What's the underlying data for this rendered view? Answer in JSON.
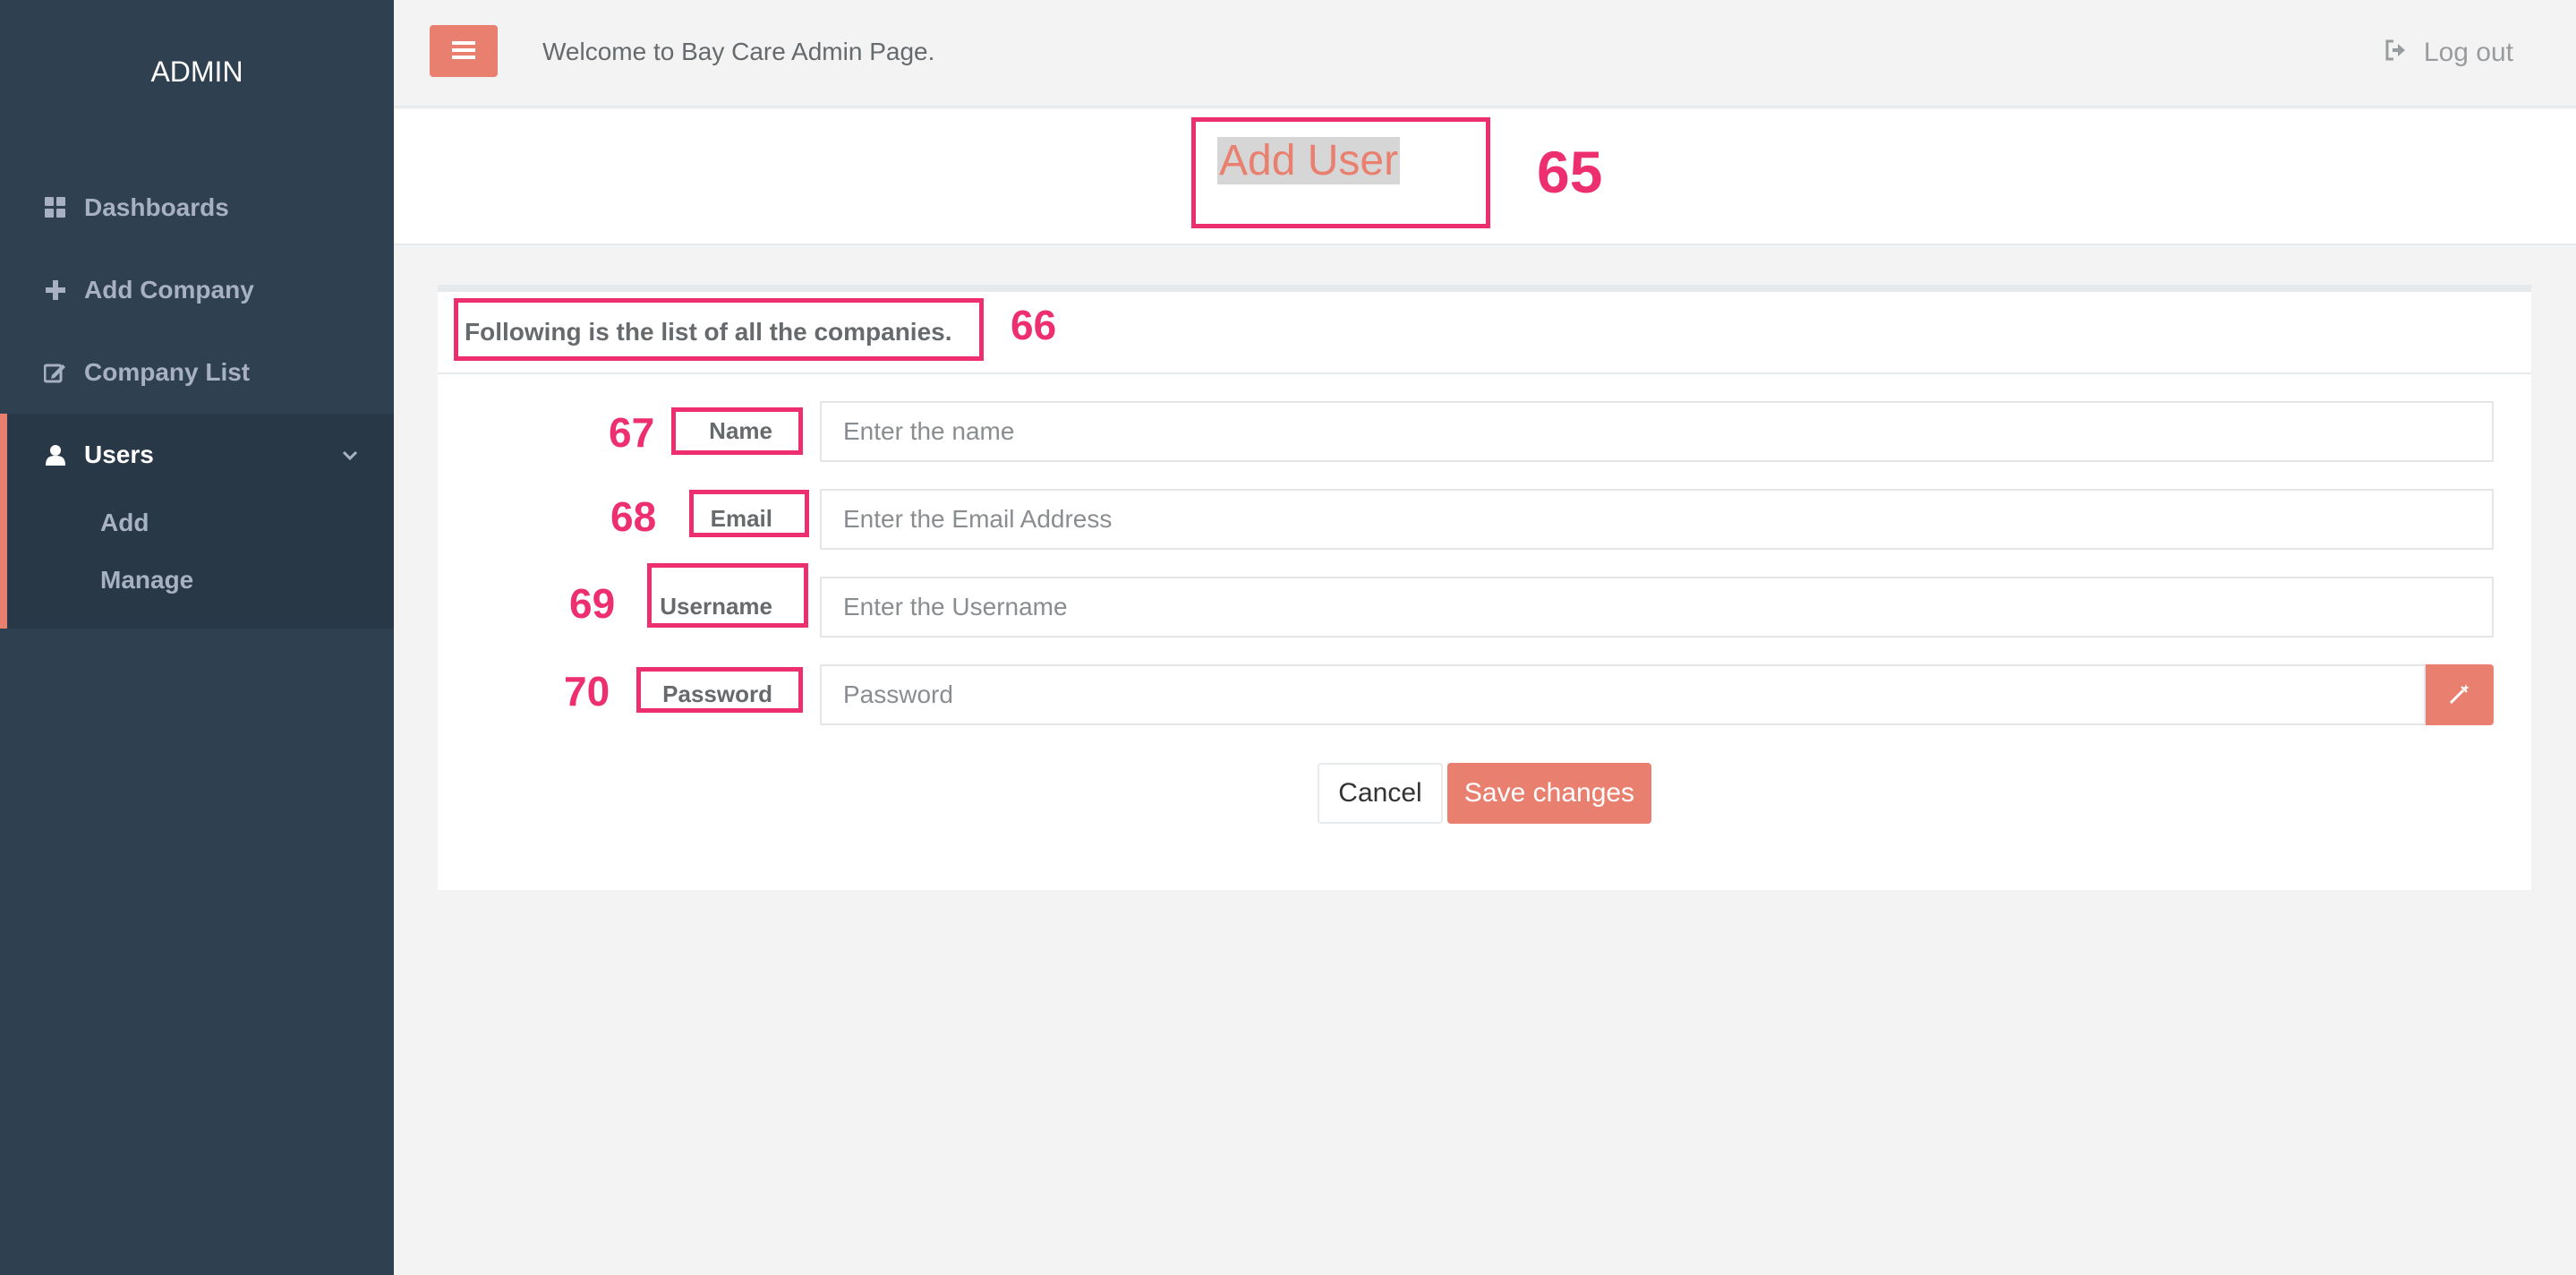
{
  "sidebar": {
    "brand": "ADMIN",
    "items": [
      {
        "label": "Dashboards",
        "icon": "grid-icon"
      },
      {
        "label": "Add Company",
        "icon": "plus-icon"
      },
      {
        "label": "Company List",
        "icon": "edit-icon"
      },
      {
        "label": "Users",
        "icon": "user-icon"
      }
    ],
    "users_submenu": [
      {
        "label": "Add"
      },
      {
        "label": "Manage"
      }
    ]
  },
  "topbar": {
    "welcome_text": "Welcome to Bay Care Admin Page.",
    "logout_label": "Log out"
  },
  "page": {
    "title": "Add User"
  },
  "form": {
    "header": "Following is the list of all the companies.",
    "fields": [
      {
        "label": "Name",
        "placeholder": "Enter the name"
      },
      {
        "label": "Email",
        "placeholder": "Enter the Email Address"
      },
      {
        "label": "Username",
        "placeholder": "Enter the Username"
      },
      {
        "label": "Password",
        "placeholder": "Password"
      }
    ],
    "cancel_label": "Cancel",
    "save_label": "Save changes"
  },
  "annotations": [
    "65",
    "66",
    "67",
    "68",
    "69",
    "70"
  ],
  "colors": {
    "accent": "#e9806f",
    "sidebar_bg": "#2f4050",
    "annotation": "#ee2f6f"
  }
}
